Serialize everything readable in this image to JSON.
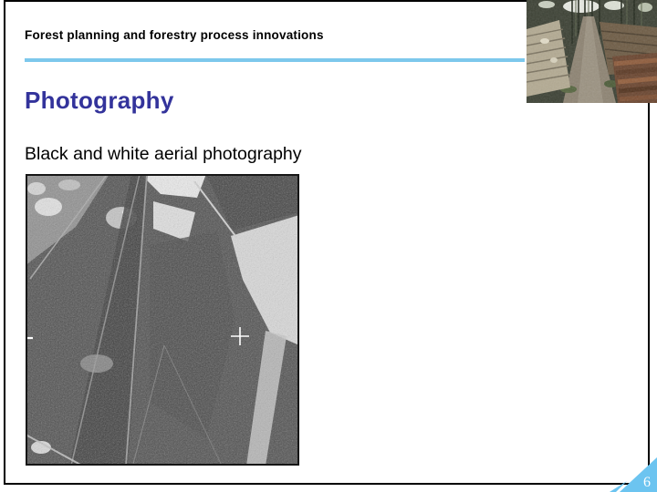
{
  "slide": {
    "header": "Forest planning and forestry process innovations",
    "title": "Photography",
    "subtitle": "Black and white aerial photography",
    "page_number": "6",
    "colors": {
      "title_blue": "#33339B",
      "rule_blue": "#7DC8EC",
      "corner_blue": "#6CC4F0",
      "header_text": "#000000",
      "page_number_text": "#FFFFFF"
    },
    "images": [
      {
        "name": "aerial-photo",
        "alt": "black and white aerial photograph with roads, clearings and fiducial cross marker"
      },
      {
        "name": "forest-road-photo",
        "alt": "forest road lined with stacked timber logs"
      }
    ]
  }
}
